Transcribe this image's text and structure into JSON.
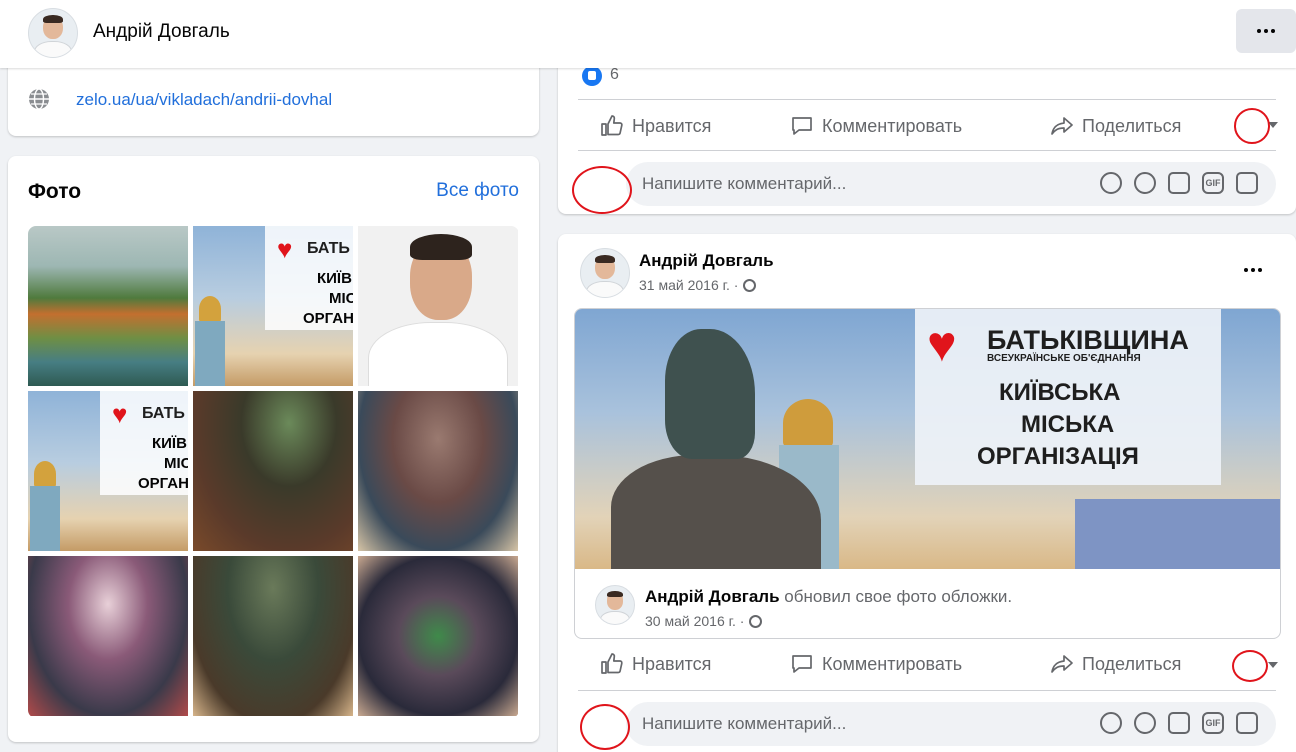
{
  "header": {
    "name": "Андрій Довгаль"
  },
  "intro": {
    "website": "zelo.ua/ua/vikladach/andrii-dovhal"
  },
  "photos": {
    "title": "Фото",
    "all_link": "Все фото",
    "tile_texts": {
      "brand_short": "БАТЬ",
      "line1_short": "КИЇВ",
      "line2_short": "МІС",
      "line3_short": "ОРГАН",
      "brand_short_b": "БАТЬ",
      "line1_short_b": "КИЇВ",
      "line2_short_b": "МІС",
      "line3_short_b": "ОРГАН"
    }
  },
  "post1": {
    "like_count": "6",
    "actions": {
      "like": "Нравится",
      "comment": "Комментировать",
      "share": "Поделиться"
    },
    "comment_placeholder": "Напишите комментарий..."
  },
  "post2": {
    "author": "Андрій Довгаль",
    "date": "31 май 2016 г. ·",
    "cover": {
      "brand": "БАТЬКІВЩИНА",
      "brand_sub": "ВСЕУКРАЇНСЬКЕ ОБ'ЄДНАННЯ",
      "line1": "КИЇВСЬКА",
      "line2": "МІСЬКА",
      "line3": "ОРГАНІЗАЦІЯ"
    },
    "shared": {
      "author": "Андрій Довгаль",
      "action": "обновил свое фото обложки.",
      "date": "30 май 2016 г. ·"
    },
    "actions": {
      "like": "Нравится",
      "comment": "Комментировать",
      "share": "Поделиться"
    },
    "comment_placeholder": "Напишите комментарий..."
  },
  "colors": {
    "link": "#216fdb",
    "accent": "#1877f2",
    "annotation_ring": "#e0141b"
  }
}
